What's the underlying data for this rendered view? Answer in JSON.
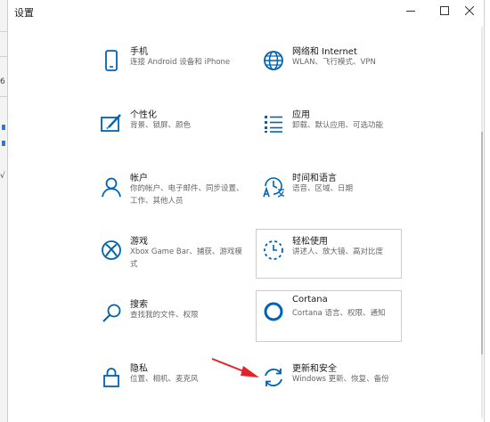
{
  "window": {
    "title": "设置"
  },
  "background_app": {
    "glyphs": [
      "6",
      "√"
    ]
  },
  "tiles": [
    {
      "title": "手机",
      "subtitle": "连接 Android 设备和 iPhone",
      "icon": "phone-icon"
    },
    {
      "title": "网络和 Internet",
      "subtitle": "WLAN、飞行模式、VPN",
      "icon": "globe-icon"
    },
    {
      "title": "个性化",
      "subtitle": "背景、锁屏、颜色",
      "icon": "personalization-icon"
    },
    {
      "title": "应用",
      "subtitle": "卸载、默认应用、可选功能",
      "icon": "apps-list-icon"
    },
    {
      "title": "帐户",
      "subtitle": "你的帐户、电子邮件、同步设置、工作、其他人员",
      "icon": "person-icon"
    },
    {
      "title": "时间和语言",
      "subtitle": "语音、区域、日期",
      "icon": "time-language-icon"
    },
    {
      "title": "游戏",
      "subtitle": "Xbox Game Bar、捕获、游戏模式",
      "icon": "xbox-icon"
    },
    {
      "title": "轻松使用",
      "subtitle": "讲述人、放大镜、高对比度",
      "icon": "ease-of-access-icon"
    },
    {
      "title": "搜索",
      "subtitle": "查找我的文件、权限",
      "icon": "search-icon"
    },
    {
      "title": "Cortana",
      "subtitle": "Cortana 语言、权限、通知",
      "icon": "cortana-icon"
    },
    {
      "title": "隐私",
      "subtitle": "位置、相机、麦克风",
      "icon": "lock-icon"
    },
    {
      "title": "更新和安全",
      "subtitle": "Windows 更新、恢复、备份",
      "icon": "update-sync-icon"
    }
  ],
  "colors": {
    "accent": "#0063b1",
    "arrow": "#e8202a",
    "subtitle": "#666666"
  }
}
